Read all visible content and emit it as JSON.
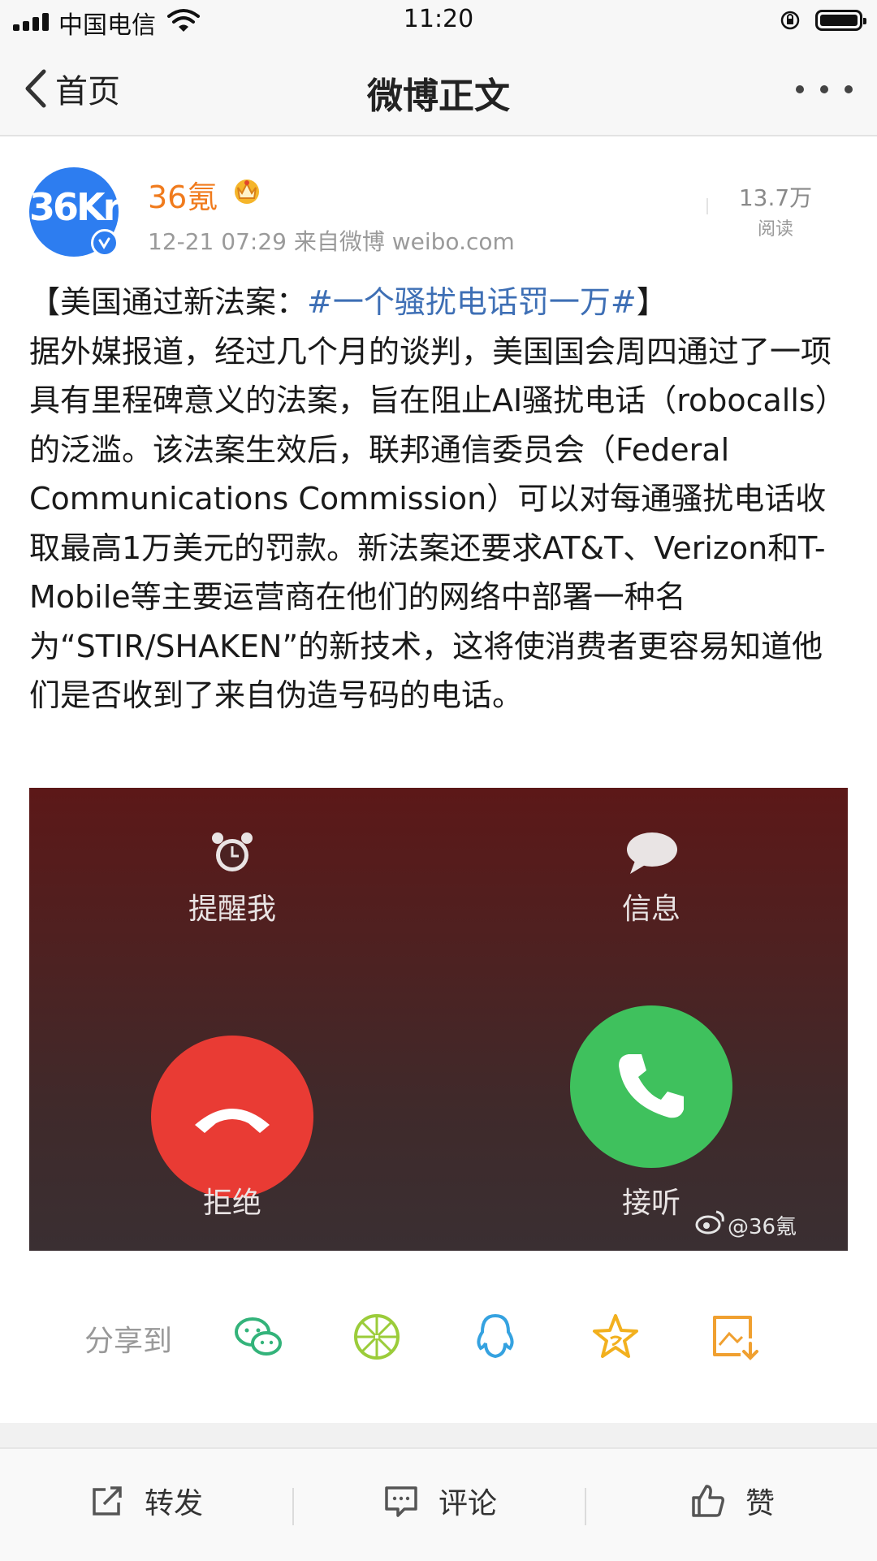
{
  "status_bar": {
    "carrier": "中国电信",
    "time": "11:20"
  },
  "nav": {
    "back_label": "首页",
    "title": "微博正文"
  },
  "post": {
    "avatar_text": "36Kr",
    "username": "36氪",
    "meta": "12-21 07:29  来自微博 weibo.com",
    "reads_count": "13.7万",
    "reads_label": "阅读",
    "text_open": "【美国通过新法案：",
    "hashtag": "#一个骚扰电话罚一万#",
    "text_close": "】",
    "body": "据外媒报道，经过几个月的谈判，美国国会周四通过了一项具有里程碑意义的法案，旨在阻止AI骚扰电话（robocalls）的泛滥。该法案生效后，联邦通信委员会（Federal Communications Commission）可以对每通骚扰电话收取最高1万美元的罚款。新法案还要求AT&T、Verizon和T-Mobile等主要运营商在他们的网络中部署一种名为“STIR/SHAKEN”的新技术，这将使消费者更容易知道他们是否收到了来自伪造号码的电话。"
  },
  "image": {
    "remind_label": "提醒我",
    "message_label": "信息",
    "decline_label": "拒绝",
    "accept_label": "接听",
    "watermark": "@36氪"
  },
  "share": {
    "label": "分享到"
  },
  "bottom_bar": {
    "repost": "转发",
    "comment": "评论",
    "like": "赞"
  }
}
